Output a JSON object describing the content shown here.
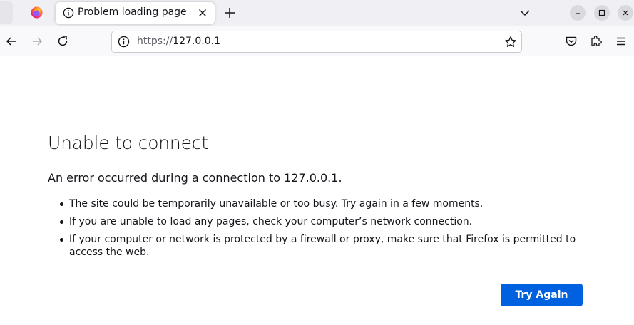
{
  "browser": {
    "tab": {
      "title": "Problem loading page"
    },
    "address_bar": {
      "scheme": "https://",
      "host": "127.0.0.1"
    }
  },
  "icons": {
    "pinned_tab": "firefox-logo-icon",
    "tab_icon": "info-circle-icon",
    "tab_close": "close-icon",
    "new_tab": "plus-icon",
    "list_all_tabs": "chevron-down-icon",
    "back": "arrow-left-icon",
    "forward": "arrow-right-icon",
    "reload": "reload-icon",
    "site_info": "info-circle-icon",
    "bookmark": "star-icon",
    "pocket": "pocket-icon",
    "extensions": "puzzle-icon",
    "menu": "hamburger-icon"
  },
  "colors": {
    "accent": "#0061e0",
    "tabstrip_bg": "#f0f0f4",
    "navbar_bg": "#f9f9fb"
  },
  "error_page": {
    "title": "Unable to connect",
    "description": "An error occurred during a connection to 127.0.0.1.",
    "items": [
      "The site could be temporarily unavailable or too busy. Try again in a few moments.",
      "If you are unable to load any pages, check your computer’s network connection.",
      "If your computer or network is protected by a firewall or proxy, make sure that Firefox is permitted to access the web."
    ],
    "try_again_label": "Try Again"
  }
}
